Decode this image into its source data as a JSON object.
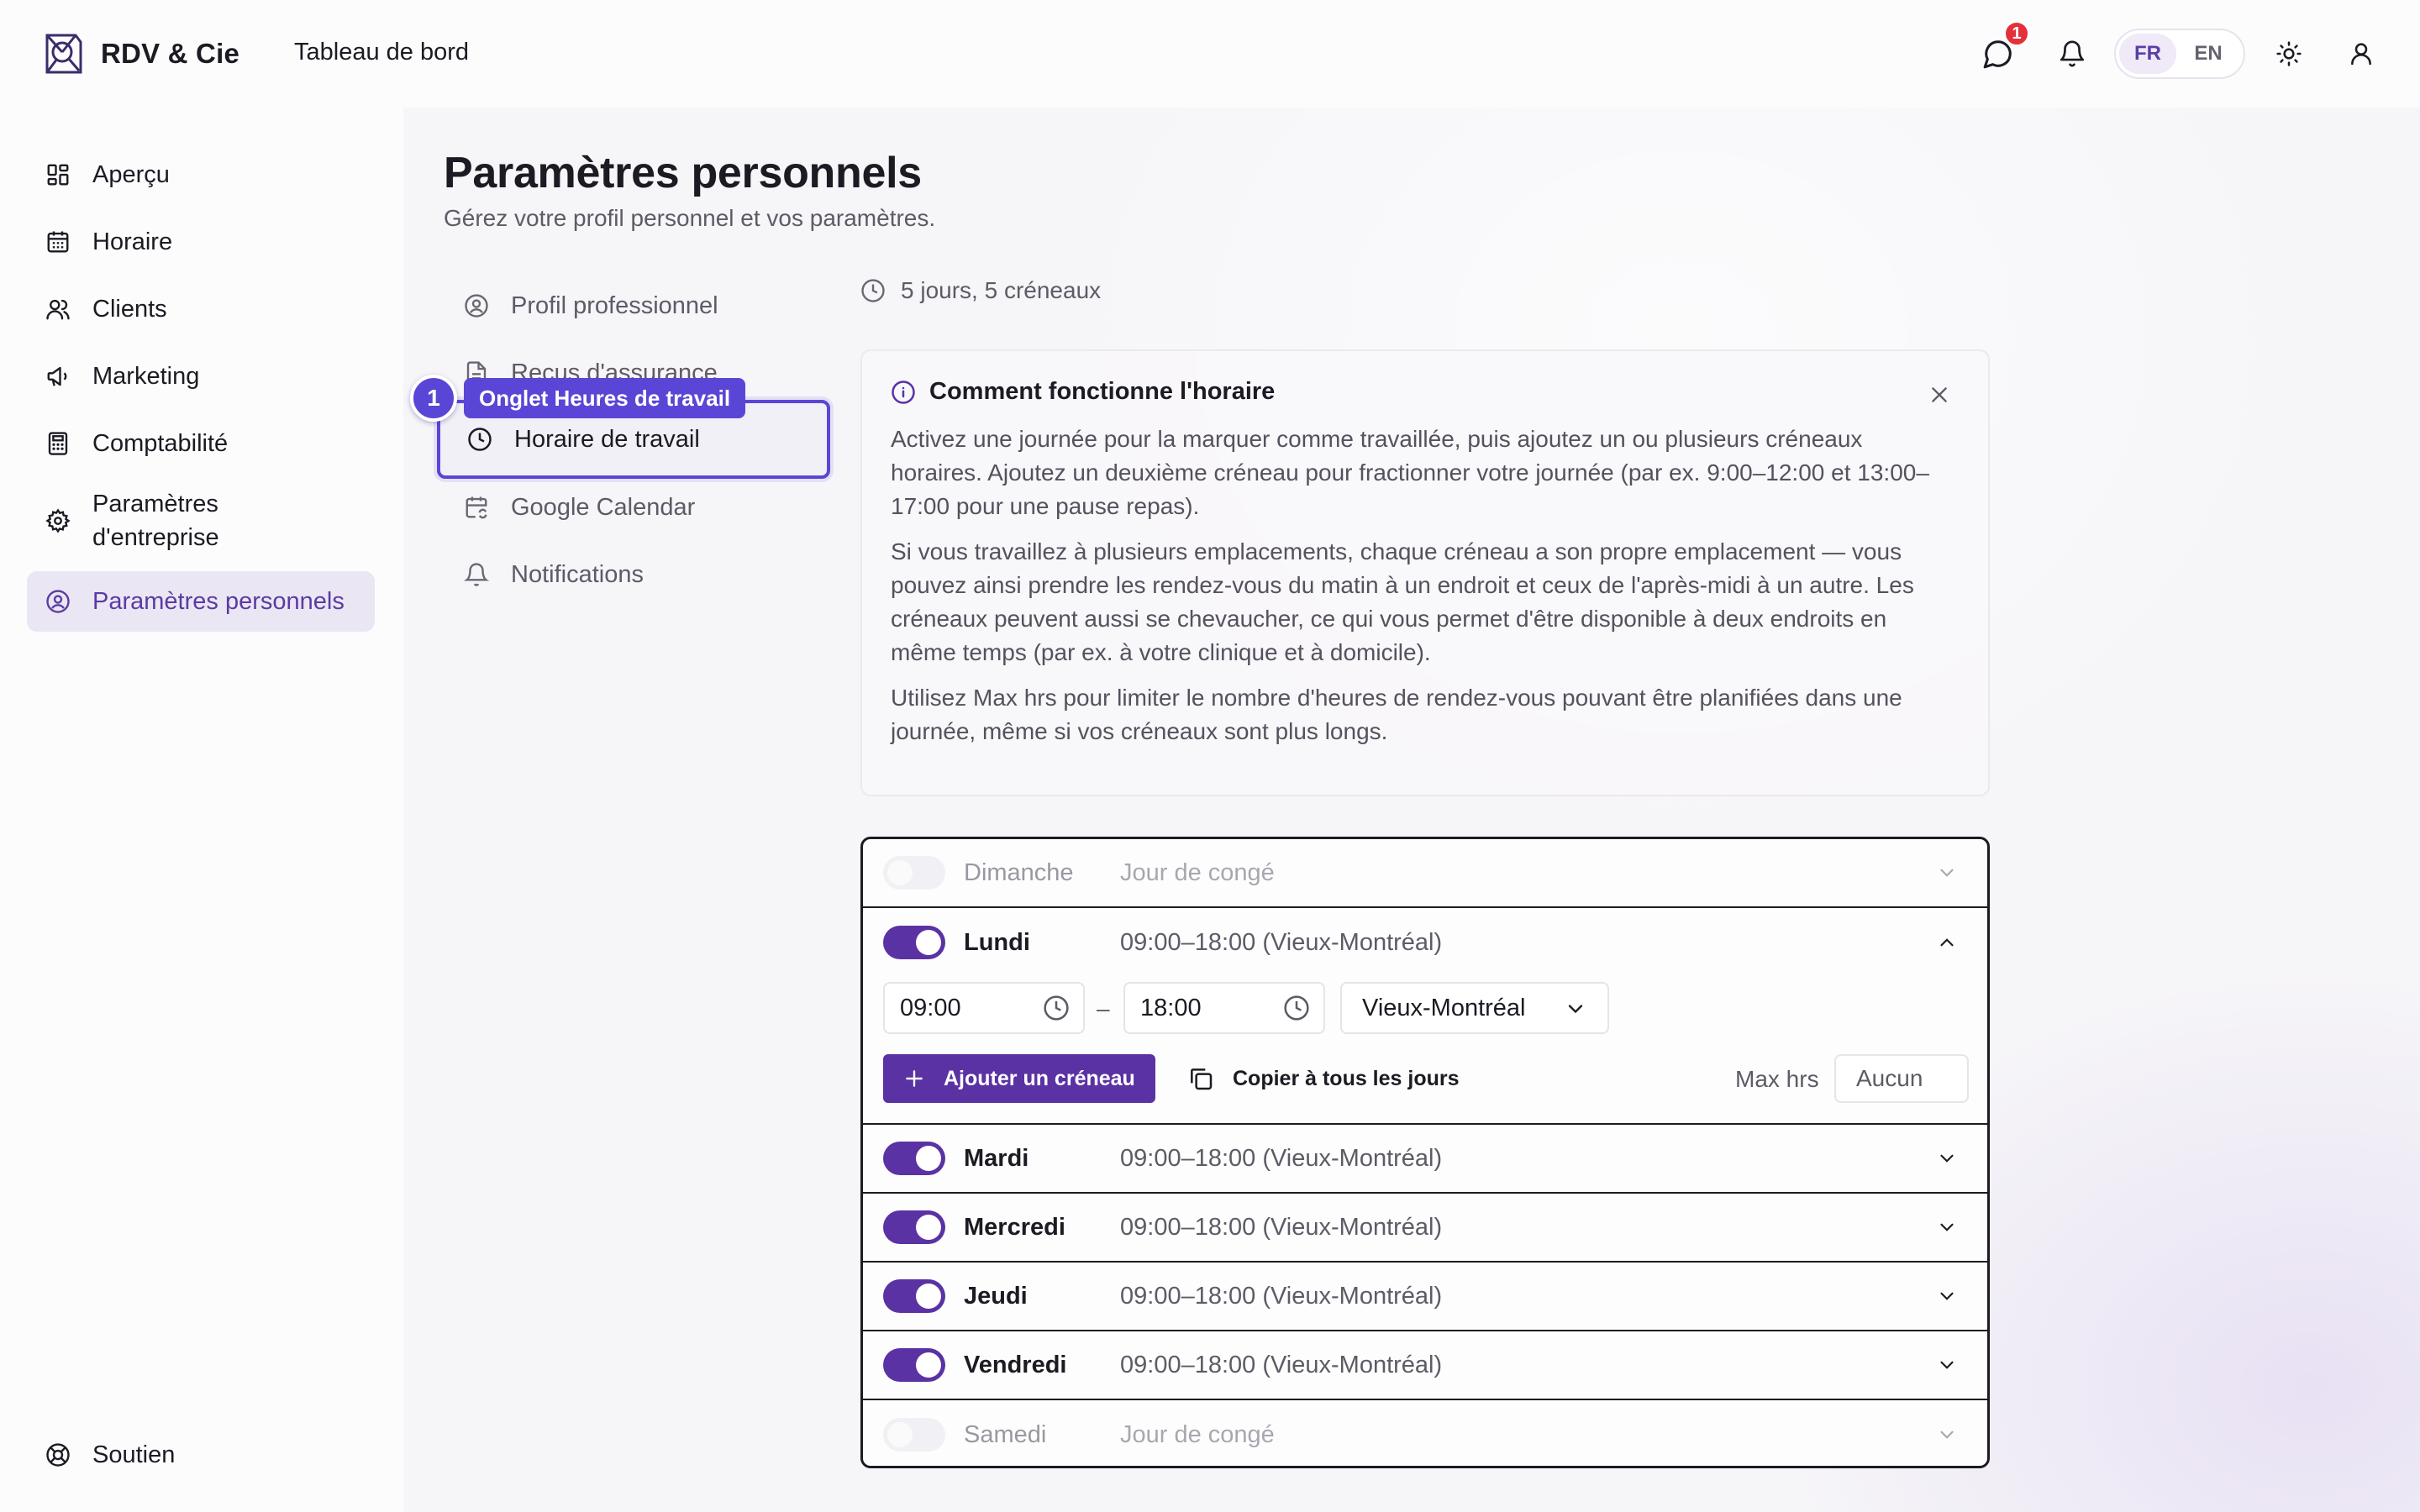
{
  "app": {
    "brand": "RDV & Cie",
    "page": "Tableau de bord"
  },
  "topbar": {
    "notification_count": "1",
    "lang_fr": "FR",
    "lang_en": "EN",
    "active_lang": "FR"
  },
  "sidebar": {
    "items": [
      {
        "label": "Aperçu",
        "icon": "grid-icon"
      },
      {
        "label": "Horaire",
        "icon": "calendar-icon"
      },
      {
        "label": "Clients",
        "icon": "users-icon"
      },
      {
        "label": "Marketing",
        "icon": "megaphone-icon"
      },
      {
        "label": "Comptabilité",
        "icon": "calculator-icon"
      },
      {
        "label": "Paramètres d'entreprise",
        "icon": "gear-icon"
      },
      {
        "label": "Paramètres personnels",
        "icon": "user-circle-icon",
        "active": true
      }
    ],
    "footer": {
      "label": "Soutien",
      "icon": "lifebuoy-icon"
    }
  },
  "main": {
    "title": "Paramètres personnels",
    "subtitle": "Gérez votre profil personnel et vos paramètres.",
    "subnav": [
      {
        "label": "Profil professionnel",
        "icon": "user-circle-icon"
      },
      {
        "label": "Reçus d'assurance",
        "icon": "document-icon"
      },
      {
        "label": "Horaire de travail",
        "icon": "clock-icon",
        "active": true
      },
      {
        "label": "Google Calendar",
        "icon": "calendar-sync-icon"
      },
      {
        "label": "Notifications",
        "icon": "bell-icon"
      }
    ],
    "annotation": {
      "number": "1",
      "label": "Onglet Heures de travail"
    },
    "summary": "5 jours, 5 créneaux",
    "info": {
      "title": "Comment fonctionne l'horaire",
      "paragraphs": [
        "Activez une journée pour la marquer comme travaillée, puis ajoutez un ou plusieurs créneaux horaires. Ajoutez un deuxième créneau pour fractionner votre journée (par ex. 9:00–12:00 et 13:00–17:00 pour une pause repas).",
        "Si vous travaillez à plusieurs emplacements, chaque créneau a son propre emplacement — vous pouvez ainsi prendre les rendez-vous du matin à un endroit et ceux de l'après-midi à un autre. Les créneaux peuvent aussi se chevaucher, ce qui vous permet d'être disponible à deux endroits en même temps (par ex. à votre clinique et à domicile).",
        "Utilisez Max hrs pour limiter le nombre d'heures de rendez-vous pouvant être planifiées dans une journée, même si vos créneaux sont plus longs."
      ]
    },
    "days": [
      {
        "name": "Dimanche",
        "enabled": false,
        "summary": "Jour de congé"
      },
      {
        "name": "Lundi",
        "enabled": true,
        "summary": "09:00–18:00 (Vieux-Montréal)",
        "expanded": true
      },
      {
        "name": "Mardi",
        "enabled": true,
        "summary": "09:00–18:00 (Vieux-Montréal)"
      },
      {
        "name": "Mercredi",
        "enabled": true,
        "summary": "09:00–18:00 (Vieux-Montréal)"
      },
      {
        "name": "Jeudi",
        "enabled": true,
        "summary": "09:00–18:00 (Vieux-Montréal)"
      },
      {
        "name": "Vendredi",
        "enabled": true,
        "summary": "09:00–18:00 (Vieux-Montréal)"
      },
      {
        "name": "Samedi",
        "enabled": false,
        "summary": "Jour de congé"
      }
    ],
    "editor": {
      "start": "09:00",
      "end": "18:00",
      "separator": "–",
      "location": "Vieux-Montréal",
      "add_slot": "Ajouter un créneau",
      "copy_all": "Copier à tous les jours",
      "max_label": "Max hrs",
      "max_placeholder": "Aucun"
    }
  },
  "colors": {
    "accent": "#5a32a3",
    "annotation": "#5a46d6",
    "badge": "#e5303a"
  }
}
